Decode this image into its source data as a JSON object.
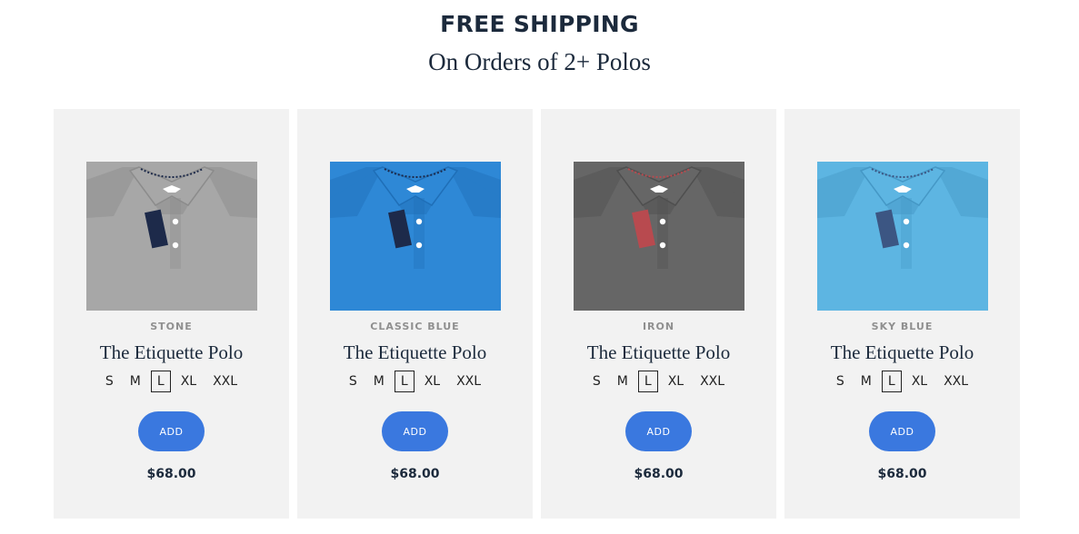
{
  "promo": {
    "headline": "FREE SHIPPING",
    "subline": "On Orders of 2+ Polos"
  },
  "products": [
    {
      "color_name": "STONE",
      "title": "The Etiquette Polo",
      "sizes": [
        "S",
        "M",
        "L",
        "XL",
        "XXL"
      ],
      "selected_size": "L",
      "add_label": "ADD",
      "price": "$68.00",
      "shirt_color": "#a7a7a7",
      "shirt_shade": "#8c8c8c",
      "placket_color": "#1d2a4a"
    },
    {
      "color_name": "CLASSIC BLUE",
      "title": "The Etiquette Polo",
      "sizes": [
        "S",
        "M",
        "L",
        "XL",
        "XXL"
      ],
      "selected_size": "L",
      "add_label": "ADD",
      "price": "$68.00",
      "shirt_color": "#2e88d6",
      "shirt_shade": "#1f6fb8",
      "placket_color": "#1d2a4a"
    },
    {
      "color_name": "IRON",
      "title": "The Etiquette Polo",
      "sizes": [
        "S",
        "M",
        "L",
        "XL",
        "XXL"
      ],
      "selected_size": "L",
      "add_label": "ADD",
      "price": "$68.00",
      "shirt_color": "#666666",
      "shirt_shade": "#4f4f4f",
      "placket_color": "#b84a4f"
    },
    {
      "color_name": "SKY BLUE",
      "title": "The Etiquette Polo",
      "sizes": [
        "S",
        "M",
        "L",
        "XL",
        "XXL"
      ],
      "selected_size": "L",
      "add_label": "ADD",
      "price": "$68.00",
      "shirt_color": "#5db5e2",
      "shirt_shade": "#4598c6",
      "placket_color": "#3c5683"
    }
  ],
  "colors": {
    "accent": "#3a78df",
    "card_bg": "#f2f2f2",
    "heading": "#1c2a3c"
  }
}
